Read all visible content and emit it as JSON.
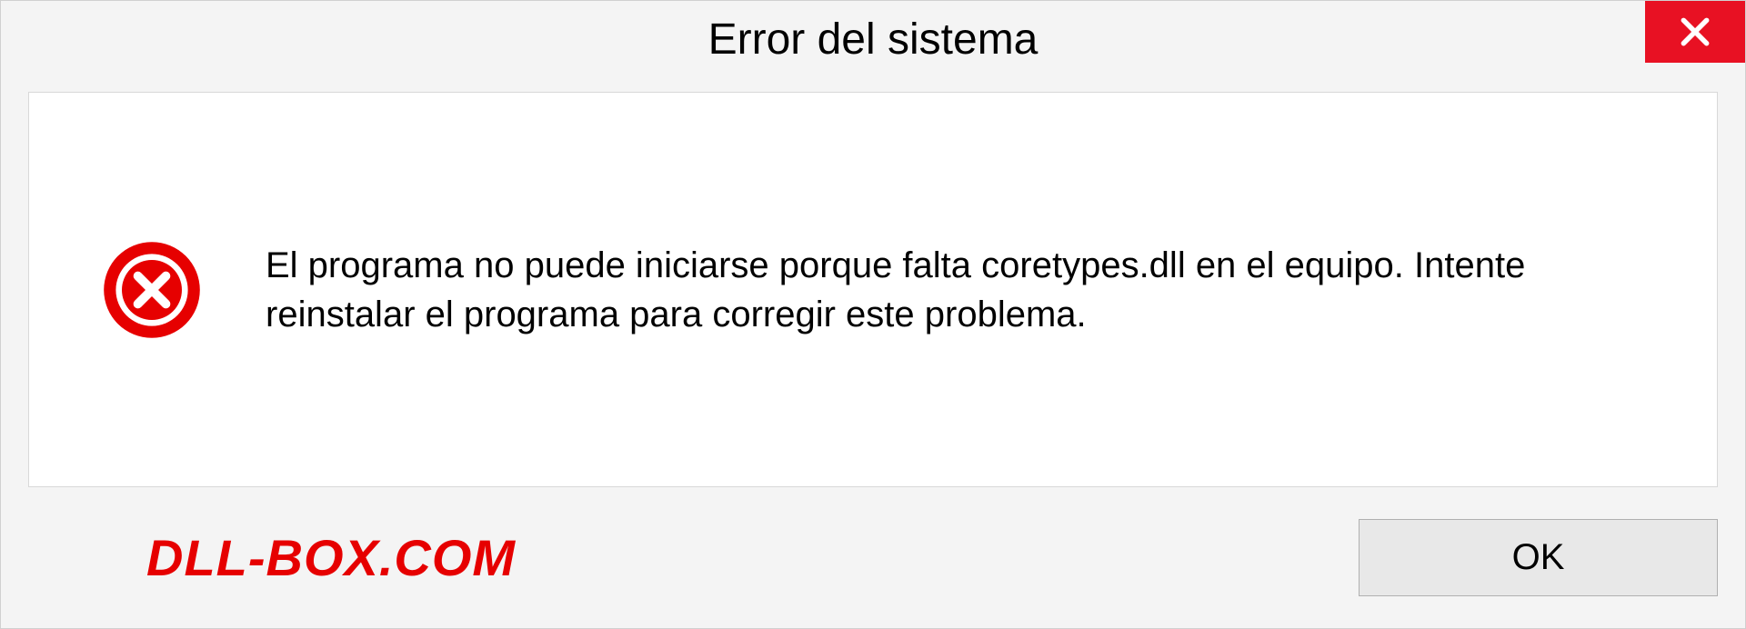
{
  "dialog": {
    "title": "Error del sistema",
    "message": "El programa no puede iniciarse porque falta coretypes.dll en el equipo. Intente reinstalar el programa para corregir este problema.",
    "ok_label": "OK"
  },
  "watermark": "DLL-BOX.COM",
  "colors": {
    "close_bg": "#e81123",
    "error_icon": "#e60000",
    "watermark": "#e60000"
  }
}
